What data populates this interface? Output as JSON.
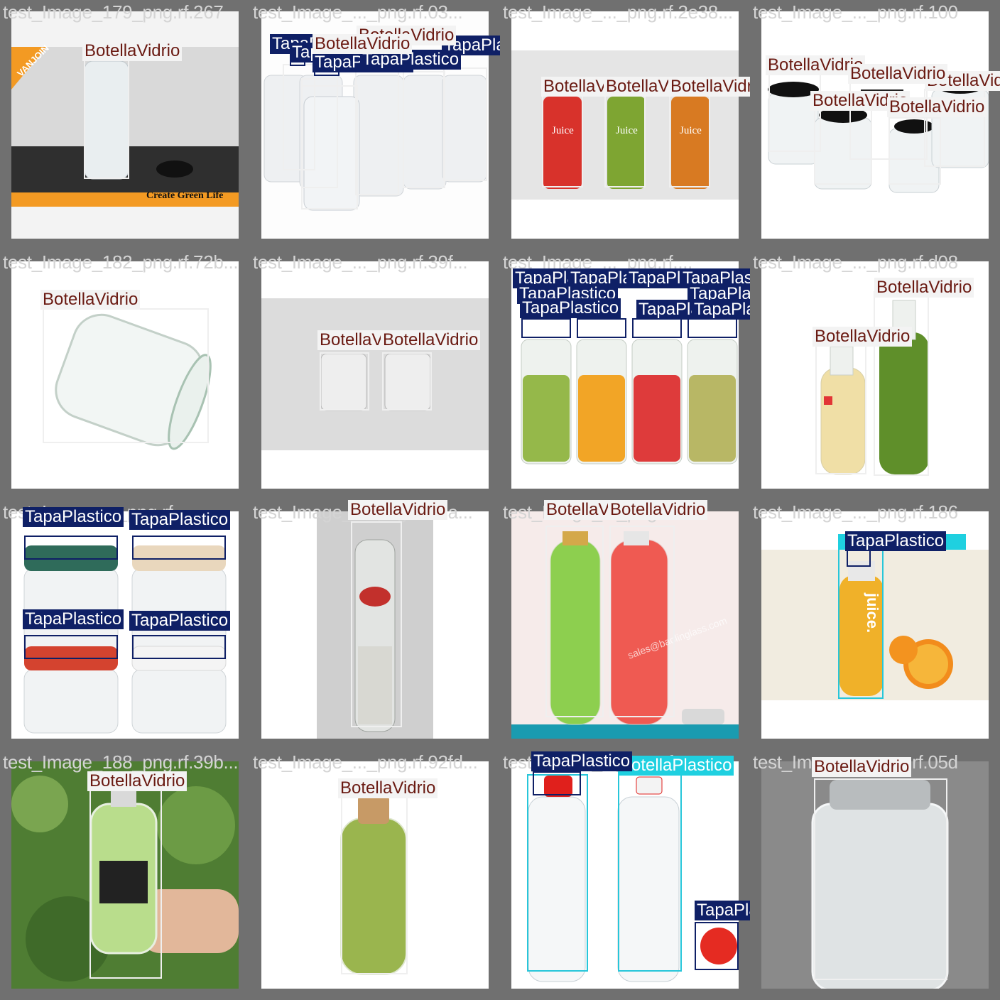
{
  "labels": {
    "glass": "BotellaVidrio",
    "cap": "TapaPlastico",
    "plastic": "BotellaPlastico"
  },
  "tiles": [
    {
      "title": "test_Image_179_png.rf.267",
      "overlay_text": "Create Green Life",
      "logo": "VANJOIN"
    },
    {
      "title": "test_Image_..._png.rf.03..."
    },
    {
      "title": "test_Image_..._png.rf.2e38..."
    },
    {
      "title": "test_Image_..._png.rf.100"
    },
    {
      "title": "test_Image_182_png.rf.72b..."
    },
    {
      "title": "test_Image_..._png.rf.39f..."
    },
    {
      "title": "test_Image_..._png.rf...."
    },
    {
      "title": "test_Image_..._png.rf.d08"
    },
    {
      "title": "test_Image_..._png.rf...."
    },
    {
      "title": "test_Image_..._png.rf.7da..."
    },
    {
      "title": "test_Image_..._png.rf....",
      "overlay_text": "sales@baolinglass.com"
    },
    {
      "title": "test_Image_..._png.rf.186",
      "overlay_text": "juice."
    },
    {
      "title": "test_Image_188_png.rf.39b..."
    },
    {
      "title": "test_Image_..._png.rf.92fd..."
    },
    {
      "title": "test_Image_..._png.rf...."
    },
    {
      "title": "test_Image_..._png.rf.05d"
    }
  ],
  "juice_word": "Juice",
  "colors": {
    "tile_bg": "#707070",
    "glass_box": "#efefef",
    "cap_box": "#0f2066",
    "plastic_box": "#27c6da",
    "glass_label_text": "#6a1a12"
  }
}
